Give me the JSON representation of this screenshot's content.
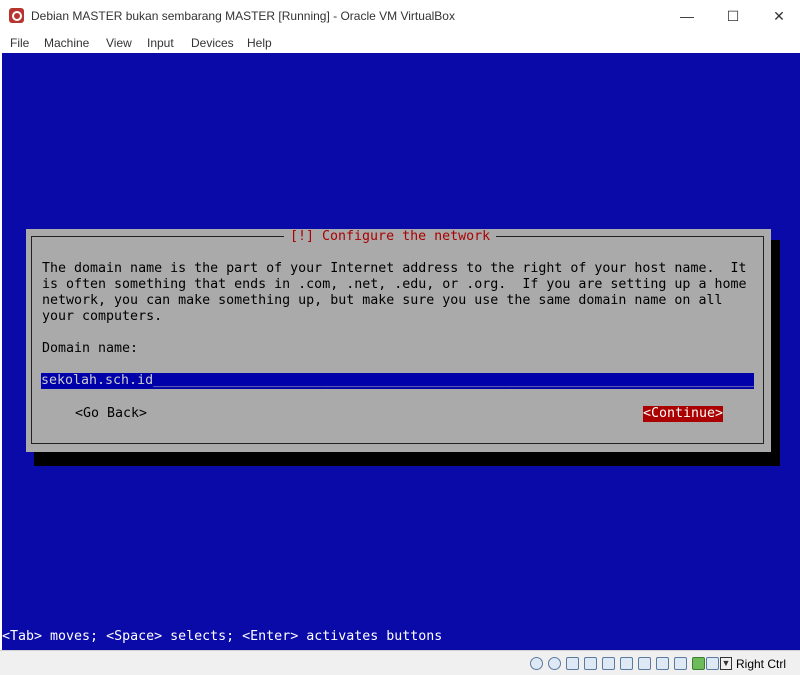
{
  "window": {
    "title": "Debian MASTER bukan sembarang MASTER [Running] - Oracle VM VirtualBox",
    "minimize": "—",
    "maximize": "☐",
    "close": "✕"
  },
  "menu": [
    "File",
    "Machine",
    "View",
    "Input",
    "Devices",
    "Help"
  ],
  "dialog": {
    "title": "[!] Configure the network",
    "description": "The domain name is the part of your Internet address to the right of your host name.  It\nis often something that ends in .com, .net, .edu, or .org.  If you are setting up a home\nnetwork, you can make something up, but make sure you use the same domain name on all\nyour computers.",
    "field_label": "Domain name:",
    "field_value": "sekolah.sch.id",
    "field_padding": "____________________________________________________________________________________",
    "go_back": "<Go Back>",
    "continue": "<Continue>"
  },
  "hint": "<Tab> moves; <Space> selects; <Enter> activates buttons",
  "statusbar": {
    "icons": [
      "hard-disk-icon",
      "optical-drive-icon",
      "audio-icon",
      "network-icon",
      "usb-icon",
      "shared-folders-icon",
      "display-icon",
      "video-capture-icon",
      "cpu-icon",
      "mouse-integration-icon",
      "keyboard-capture-icon"
    ],
    "host_key": "Right Ctrl"
  },
  "colors": {
    "vm_background": "#0a0aa8",
    "dialog_background": "#aaaaaa",
    "title_red": "#aa0000",
    "field_background": "#0000aa",
    "button_selected": "#aa0000"
  }
}
